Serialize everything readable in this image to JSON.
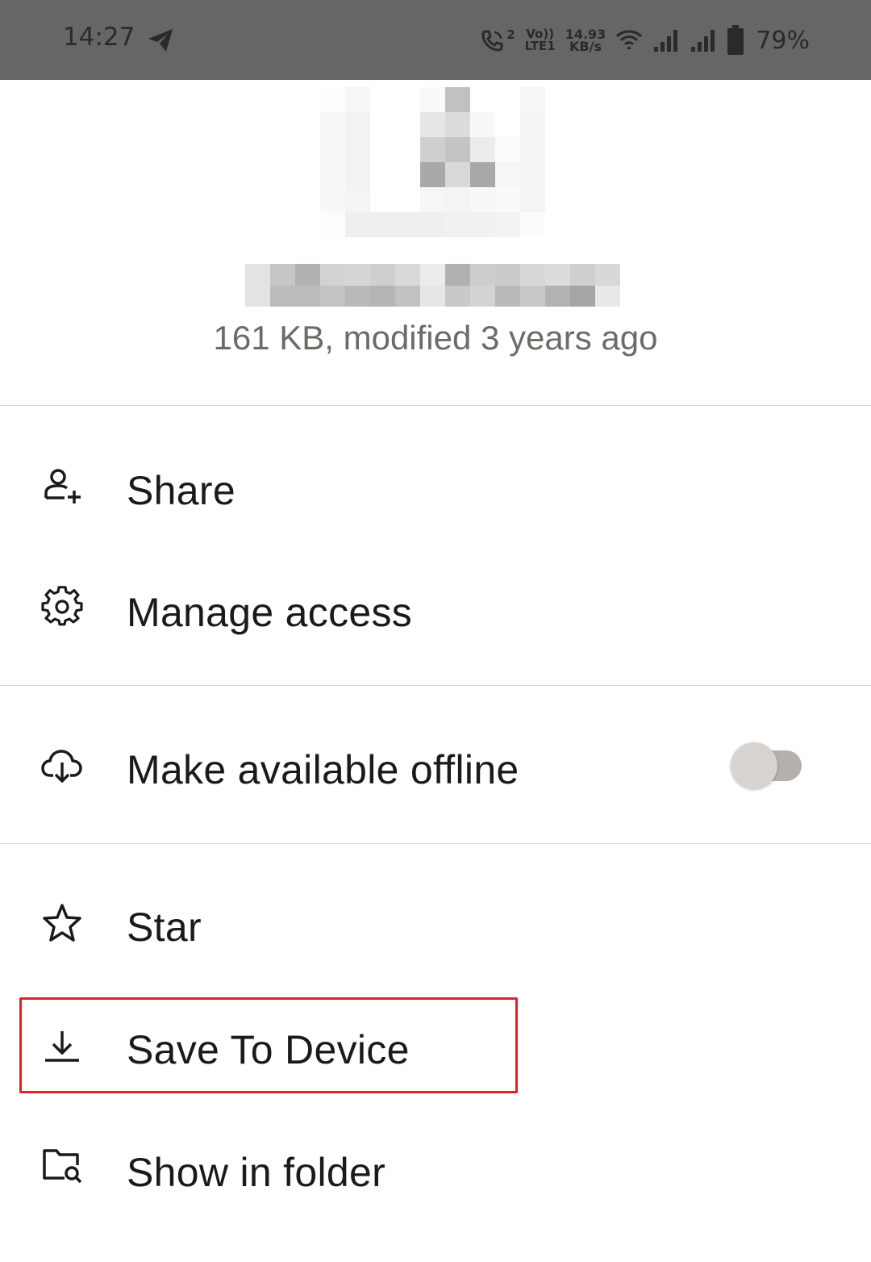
{
  "status_bar": {
    "time": "14:27",
    "call_sim": "2",
    "volte_top": "Vo))",
    "volte_bottom": "LTE1",
    "speed_value": "14.93",
    "speed_unit": "KB/s",
    "battery_percent": "79%"
  },
  "file": {
    "meta": "161 KB, modified 3 years ago"
  },
  "menu": {
    "share": "Share",
    "manage_access": "Manage access",
    "offline": "Make available offline",
    "offline_enabled": false,
    "star": "Star",
    "save_to_device": "Save To Device",
    "show_in_folder": "Show in folder"
  },
  "colors": {
    "status_bar_bg": "#666666",
    "text_primary": "#1e1919",
    "text_secondary": "#6f6a66",
    "highlight": "#e0202a",
    "divider": "#d9d6d3"
  }
}
